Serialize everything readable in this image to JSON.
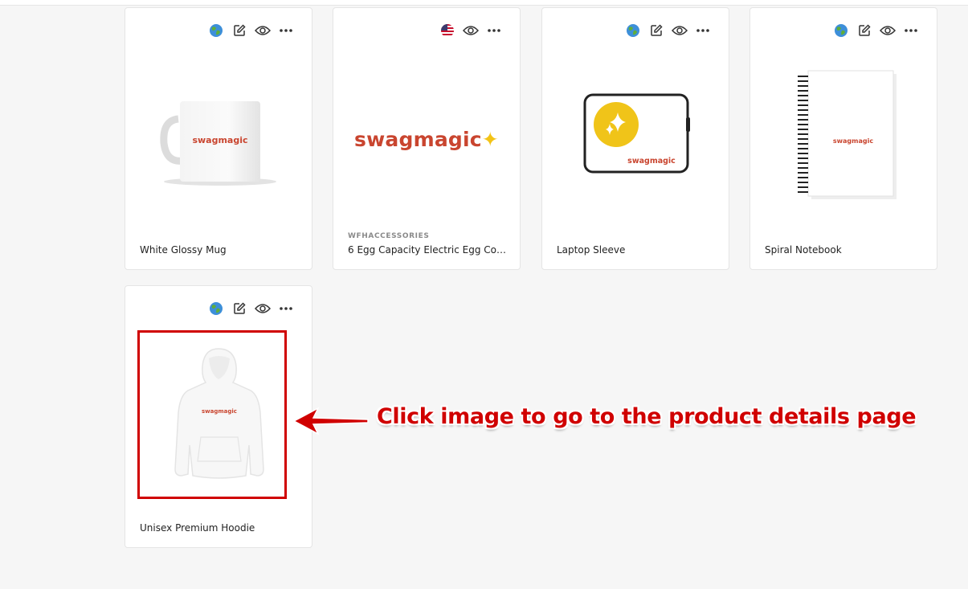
{
  "products": [
    {
      "title": "White Glossy Mug",
      "vendor": "",
      "market_icon": "globe-icon",
      "logo_text": "swagmagic"
    },
    {
      "title": "6 Egg Capacity Electric Egg Cook...",
      "vendor": "WFHACCESSORIES",
      "market_icon": "us-flag-icon",
      "logo_text": "swagmagic"
    },
    {
      "title": "Laptop Sleeve",
      "vendor": "",
      "market_icon": "globe-icon",
      "logo_text": "swagmagic"
    },
    {
      "title": "Spiral Notebook",
      "vendor": "",
      "market_icon": "globe-icon",
      "logo_text": "swagmagic"
    },
    {
      "title": "Unisex Premium Hoodie",
      "vendor": "",
      "market_icon": "globe-icon",
      "logo_text": "swagmagic"
    }
  ],
  "annotation": {
    "text": "Click image to go to the product details page",
    "color": "#d00000"
  },
  "colors": {
    "brand": "#c9452f",
    "spark": "#f3c316",
    "highlight": "#d00000"
  }
}
